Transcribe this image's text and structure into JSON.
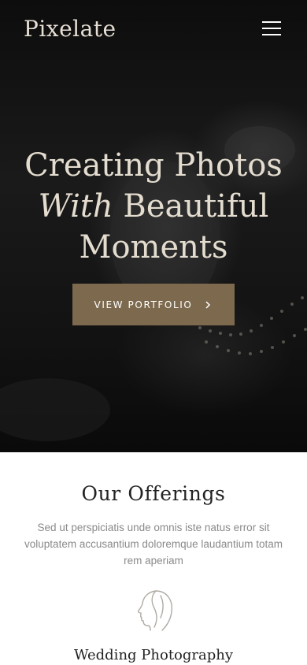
{
  "nav": {
    "logo": "Pixelate",
    "menu_icon": "hamburger-menu-icon"
  },
  "hero": {
    "title_line1": "Creating Photos",
    "title_line2_italic": "With",
    "title_line2_rest": "Beautiful",
    "title_line3": "Moments",
    "cta_label": "VIEW PORTFOLIO",
    "cta_icon": "chevron-right-icon",
    "accent_color": "#7d6a4e"
  },
  "offerings": {
    "title": "Our Offerings",
    "description": "Sed ut perspiciatis unde omnis iste natus error sit voluptatem accusantium doloremque laudantium totam rem aperiam",
    "items": [
      {
        "icon": "bride-profile-icon",
        "title": "Wedding Photography"
      }
    ]
  }
}
